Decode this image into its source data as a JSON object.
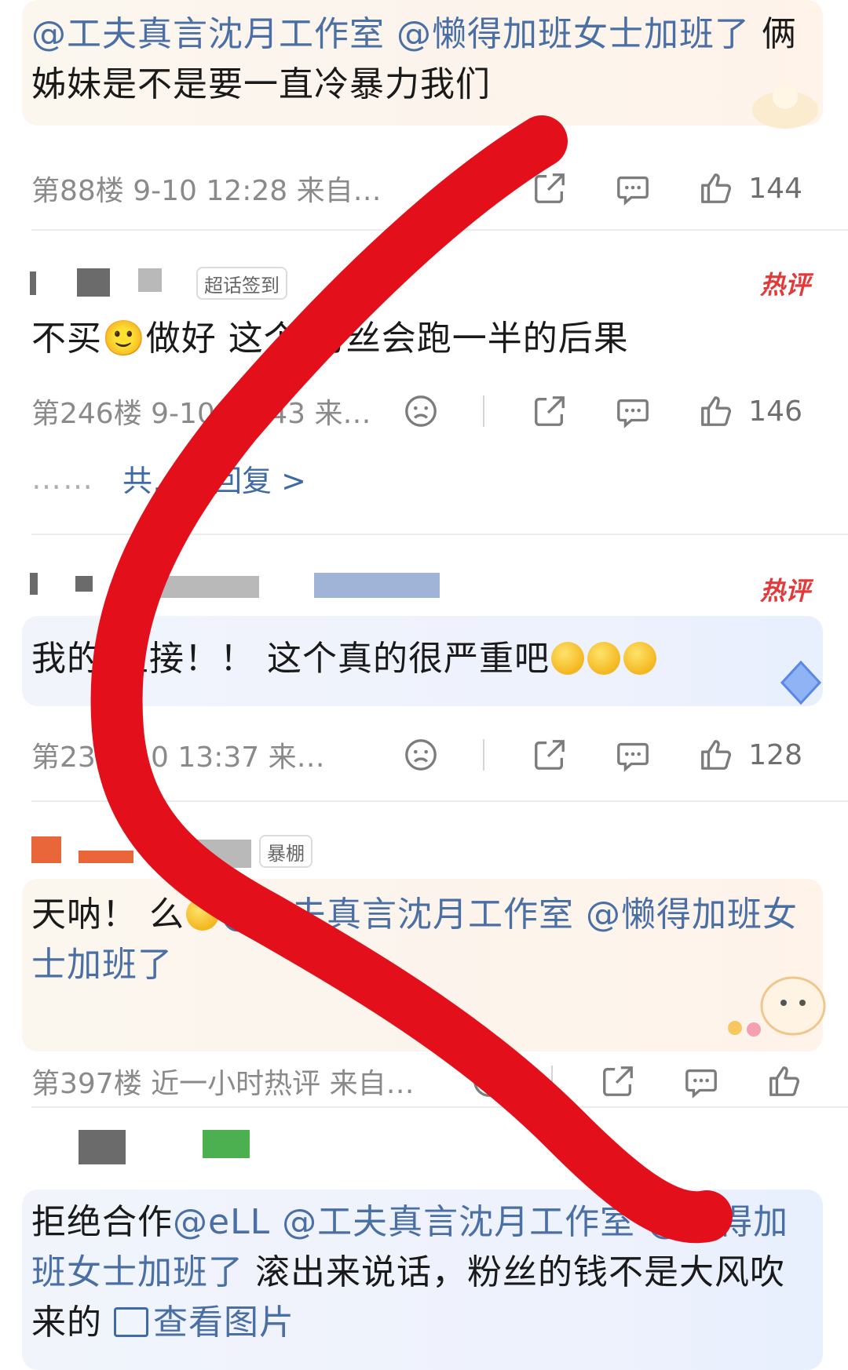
{
  "comments": [
    {
      "text_parts": [
        "@工夫真言沈月工作室 @懒得加班女士加班了",
        " 俩姊妹是不是要一直冷暴力我们"
      ],
      "meta": "第88楼 9-10 12:28 来自…",
      "likes": "144"
    },
    {
      "badge": "热评",
      "tag": "超话签到",
      "text": "不买🙂做好 这个 粉丝会跑一半的后果",
      "meta": "第246楼 9-10 13:43 来…",
      "likes": "146",
      "replies": "共…条回复 >"
    },
    {
      "badge": "热评",
      "text": "我的 拒接！！ 这个真的很严重吧",
      "meta": "第23 9-10 13:37 来…",
      "likes": "128"
    },
    {
      "tag": "暴棚",
      "text_parts": [
        "天呐！ 么",
        "@工夫真言沈月工作室 @懒得加班女士加班了"
      ],
      "meta": "第397楼 近一小时热评 来自…"
    },
    {
      "text_parts": [
        "拒绝合作",
        "@eLL @工夫真言沈月工作室 @懒得加班女士加班了",
        " 滚出来说话，粉丝的钱不是大风吹来的 ",
        "查看图片"
      ]
    }
  ],
  "icons": [
    "sad-face-icon",
    "share-icon",
    "comment-icon",
    "thumbs-up-icon",
    "image-icon"
  ],
  "colors": {
    "mention": "#4a6fa5",
    "hot_badge": "#e23a3a",
    "overlay_stroke": "#e3101b"
  }
}
